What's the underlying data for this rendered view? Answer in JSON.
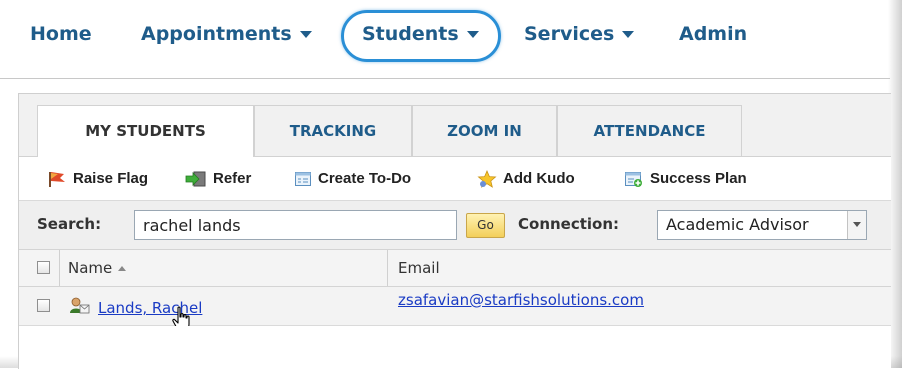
{
  "nav": {
    "items": [
      {
        "label": "Home",
        "has_caret": false
      },
      {
        "label": "Appointments",
        "has_caret": true
      },
      {
        "label": "Students",
        "has_caret": true,
        "highlighted": true
      },
      {
        "label": "Services",
        "has_caret": true
      },
      {
        "label": "Admin",
        "has_caret": false
      }
    ],
    "highlight_color": "#2a8fd6",
    "link_color": "#1f5c8a"
  },
  "tabs": [
    {
      "label": "MY STUDENTS",
      "active": true
    },
    {
      "label": "TRACKING",
      "active": false
    },
    {
      "label": "ZOOM IN",
      "active": false
    },
    {
      "label": "ATTENDANCE",
      "active": false
    }
  ],
  "toolbar": {
    "items": [
      {
        "label": "Raise Flag",
        "icon": "flag-icon"
      },
      {
        "label": "Refer",
        "icon": "refer-icon"
      },
      {
        "label": "Create To-Do",
        "icon": "todo-icon"
      },
      {
        "label": "Add Kudo",
        "icon": "star-icon"
      },
      {
        "label": "Success Plan",
        "icon": "plan-icon"
      }
    ]
  },
  "search": {
    "label": "Search:",
    "value": "rachel lands",
    "go_label": "Go",
    "connection_label": "Connection:",
    "connection_value": "Academic Advisor"
  },
  "table": {
    "columns": [
      "Name",
      "Email"
    ],
    "rows": [
      {
        "name": "Lands, Rachel",
        "email": "zsafavian@starfishsolutions.com"
      }
    ]
  },
  "colors": {
    "link": "#1a3bc4",
    "go_button": "#f3cf5a"
  }
}
